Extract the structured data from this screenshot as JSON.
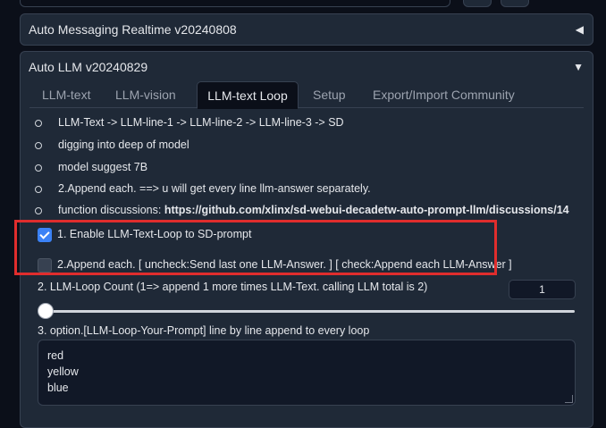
{
  "accordions": [
    {
      "title": "Auto Messaging Realtime v20240808",
      "arrow": "◀"
    },
    {
      "title": "Auto LLM v20240829",
      "arrow": "▼"
    }
  ],
  "tabs": [
    {
      "label": "LLM-text"
    },
    {
      "label": "LLM-vision"
    },
    {
      "label": "LLM-text Loop"
    },
    {
      "label": "Setup"
    },
    {
      "label": "Export/Import Community"
    }
  ],
  "info_list": [
    "LLM-Text -> LLM-line-1 -> LLM-line-2 -> LLM-line-3 -> SD",
    "digging into deep of model",
    "model suggest 7B",
    "2.Append each. ==> u will get every line llm-answer separately."
  ],
  "discussion": {
    "prefix": "function discussions: ",
    "link": "https://github.com/xlinx/sd-webui-decadetw-auto-prompt-llm/discussions/14"
  },
  "checkboxes": [
    {
      "label": "1. Enable LLM-Text-Loop to SD-prompt",
      "checked": true
    },
    {
      "label": "2.Append each. [ uncheck:Send last one LLM-Answer. ] [ check:Append each LLM-Answer ]",
      "checked": false
    }
  ],
  "loop_count": {
    "label": "2. LLM-Loop Count (1=> append 1 more times LLM-Text. calling LLM total is 2)",
    "value": "1"
  },
  "your_prompt": {
    "label": "3. option.[LLM-Loop-Your-Prompt] line by line append to every loop",
    "lines": [
      "red",
      "yellow",
      "blue"
    ]
  },
  "colors": {
    "background": "#0b0f19",
    "panel": "#1f2937",
    "accent": "#3b82f6",
    "highlight_box": "#e02d2d"
  }
}
